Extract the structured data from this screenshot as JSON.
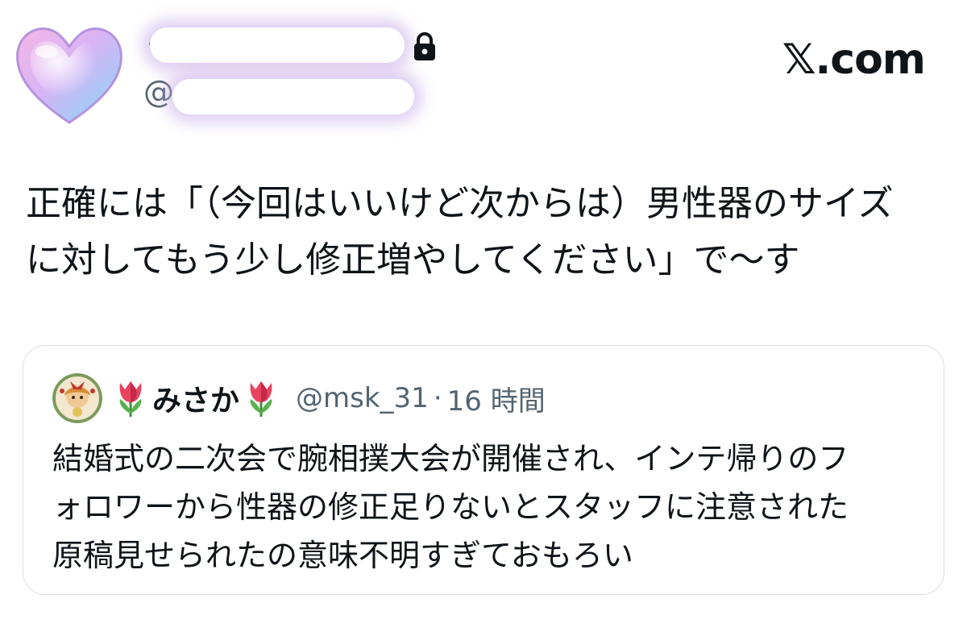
{
  "author": {
    "name_visible": ". .",
    "handle_prefix": "@",
    "protected_icon": "lock-icon",
    "avatar_icon": "heart-avatar"
  },
  "brand": {
    "label": "𝕏.com"
  },
  "tweet": {
    "text": "正確には「（今回はいいけど次からは）男性器のサイズ\nに対してもう少し修正増やしてください」で〜す"
  },
  "quote": {
    "avatar_icon": "user-avatar",
    "name_prefix_icon": "tulip-icon",
    "display_name": "みさか",
    "name_suffix_icon": "tulip-icon",
    "handle": "@msk_31",
    "separator": "·",
    "time": "16 時間",
    "text": "結婚式の二次会で腕相撲大会が開催され、インテ帰りのフ\nォロワーから性器の修正足りないとスタッフに注意された\n原稿見せられたの意味不明すぎておもろい"
  },
  "colors": {
    "text_primary": "#0f1419",
    "text_secondary": "#536471",
    "card_border": "#d9dee3",
    "redaction_glow": "#c4a8e8"
  }
}
